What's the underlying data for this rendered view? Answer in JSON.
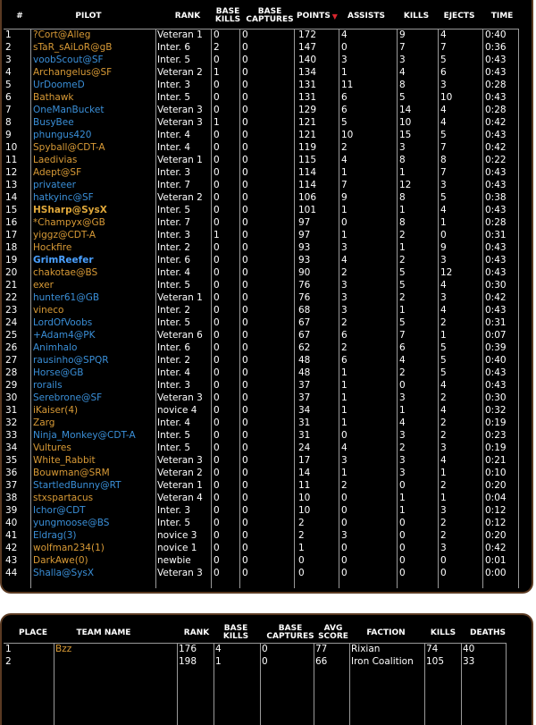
{
  "pilot_table": {
    "headers": {
      "num": "#",
      "pilot": "PILOT",
      "rank": "RANK",
      "base_kills": "BASE KILLS",
      "base_captures": "BASE CAPTURES",
      "points": "POINTS",
      "assists": "ASSISTS",
      "kills": "KILLS",
      "ejects": "EJECTS",
      "time": "TIME"
    },
    "sort_indicator": "▼",
    "colors": {
      "orange": "#d89a36",
      "blue": "#3a8fd8",
      "border": "#5a3a22",
      "sort": "#d8262e"
    },
    "rows": [
      {
        "num": "1",
        "pilot": "?Cort@Alleg",
        "team": "orange",
        "rank": "Veteran 1",
        "bk": "0",
        "bc": "0",
        "points": "172",
        "assists": "4",
        "kills": "9",
        "ejects": "4",
        "time": "0:40"
      },
      {
        "num": "2",
        "pilot": "sTaR_sAiLoR@gB",
        "team": "orange",
        "rank": "Inter. 6",
        "bk": "2",
        "bc": "0",
        "points": "147",
        "assists": "0",
        "kills": "7",
        "ejects": "7",
        "time": "0:36"
      },
      {
        "num": "3",
        "pilot": "voobScout@SF",
        "team": "blue",
        "rank": "Inter. 5",
        "bk": "0",
        "bc": "0",
        "points": "140",
        "assists": "3",
        "kills": "3",
        "ejects": "5",
        "time": "0:43"
      },
      {
        "num": "4",
        "pilot": "Archangelus@SF",
        "team": "orange",
        "rank": "Veteran 2",
        "bk": "1",
        "bc": "0",
        "points": "134",
        "assists": "1",
        "kills": "4",
        "ejects": "6",
        "time": "0:43"
      },
      {
        "num": "5",
        "pilot": "UrDoomeD",
        "team": "blue",
        "rank": "Inter. 3",
        "bk": "0",
        "bc": "0",
        "points": "131",
        "assists": "11",
        "kills": "8",
        "ejects": "3",
        "time": "0:28"
      },
      {
        "num": "6",
        "pilot": "Bathawk",
        "team": "orange",
        "rank": "Inter. 5",
        "bk": "0",
        "bc": "0",
        "points": "131",
        "assists": "6",
        "kills": "5",
        "ejects": "10",
        "time": "0:43"
      },
      {
        "num": "7",
        "pilot": "OneManBucket",
        "team": "blue",
        "rank": "Veteran 3",
        "bk": "0",
        "bc": "0",
        "points": "129",
        "assists": "6",
        "kills": "14",
        "ejects": "4",
        "time": "0:28"
      },
      {
        "num": "8",
        "pilot": "BusyBee",
        "team": "blue",
        "rank": "Veteran 3",
        "bk": "1",
        "bc": "0",
        "points": "121",
        "assists": "5",
        "kills": "10",
        "ejects": "4",
        "time": "0:42"
      },
      {
        "num": "9",
        "pilot": "phungus420",
        "team": "blue",
        "rank": "Inter. 4",
        "bk": "0",
        "bc": "0",
        "points": "121",
        "assists": "10",
        "kills": "15",
        "ejects": "5",
        "time": "0:43"
      },
      {
        "num": "10",
        "pilot": "Spyball@CDT-A",
        "team": "orange",
        "rank": "Inter. 4",
        "bk": "0",
        "bc": "0",
        "points": "119",
        "assists": "2",
        "kills": "3",
        "ejects": "7",
        "time": "0:42"
      },
      {
        "num": "11",
        "pilot": "Laedivias",
        "team": "orange",
        "rank": "Veteran 1",
        "bk": "0",
        "bc": "0",
        "points": "115",
        "assists": "4",
        "kills": "8",
        "ejects": "8",
        "time": "0:22"
      },
      {
        "num": "12",
        "pilot": "Adept@SF",
        "team": "orange",
        "rank": "Inter. 3",
        "bk": "0",
        "bc": "0",
        "points": "114",
        "assists": "1",
        "kills": "1",
        "ejects": "7",
        "time": "0:43"
      },
      {
        "num": "13",
        "pilot": "privateer",
        "team": "blue",
        "rank": "Inter. 7",
        "bk": "0",
        "bc": "0",
        "points": "114",
        "assists": "7",
        "kills": "12",
        "ejects": "3",
        "time": "0:43"
      },
      {
        "num": "14",
        "pilot": "hatkyinc@SF",
        "team": "blue",
        "rank": "Veteran 2",
        "bk": "0",
        "bc": "0",
        "points": "106",
        "assists": "9",
        "kills": "8",
        "ejects": "5",
        "time": "0:38"
      },
      {
        "num": "15",
        "pilot": "HSharp@SysX",
        "team": "orange-bold",
        "rank": "Inter. 5",
        "bk": "0",
        "bc": "0",
        "points": "101",
        "assists": "1",
        "kills": "1",
        "ejects": "4",
        "time": "0:43"
      },
      {
        "num": "16",
        "pilot": "*Champyx@GB",
        "team": "orange",
        "rank": "Inter. 7",
        "bk": "0",
        "bc": "0",
        "points": "97",
        "assists": "0",
        "kills": "8",
        "ejects": "1",
        "time": "0:28"
      },
      {
        "num": "17",
        "pilot": "yiggz@CDT-A",
        "team": "orange",
        "rank": "Inter. 3",
        "bk": "1",
        "bc": "0",
        "points": "97",
        "assists": "1",
        "kills": "2",
        "ejects": "0",
        "time": "0:31"
      },
      {
        "num": "18",
        "pilot": "Hockfire",
        "team": "orange",
        "rank": "Inter. 2",
        "bk": "0",
        "bc": "0",
        "points": "93",
        "assists": "3",
        "kills": "1",
        "ejects": "9",
        "time": "0:43"
      },
      {
        "num": "19",
        "pilot": "GrimReefer",
        "team": "blue-bold",
        "rank": "Inter. 6",
        "bk": "0",
        "bc": "0",
        "points": "93",
        "assists": "4",
        "kills": "2",
        "ejects": "3",
        "time": "0:43"
      },
      {
        "num": "20",
        "pilot": "chakotae@BS",
        "team": "orange",
        "rank": "Inter. 4",
        "bk": "0",
        "bc": "0",
        "points": "90",
        "assists": "2",
        "kills": "5",
        "ejects": "12",
        "time": "0:43"
      },
      {
        "num": "21",
        "pilot": "exer",
        "team": "orange",
        "rank": "Inter. 5",
        "bk": "0",
        "bc": "0",
        "points": "76",
        "assists": "3",
        "kills": "5",
        "ejects": "4",
        "time": "0:30"
      },
      {
        "num": "22",
        "pilot": "hunter61@GB",
        "team": "blue",
        "rank": "Veteran 1",
        "bk": "0",
        "bc": "0",
        "points": "76",
        "assists": "3",
        "kills": "2",
        "ejects": "3",
        "time": "0:42"
      },
      {
        "num": "23",
        "pilot": "vineco",
        "team": "orange",
        "rank": "Inter. 2",
        "bk": "0",
        "bc": "0",
        "points": "68",
        "assists": "3",
        "kills": "1",
        "ejects": "4",
        "time": "0:43"
      },
      {
        "num": "24",
        "pilot": "LordOfVoobs",
        "team": "blue",
        "rank": "Inter. 5",
        "bk": "0",
        "bc": "0",
        "points": "67",
        "assists": "2",
        "kills": "5",
        "ejects": "2",
        "time": "0:31"
      },
      {
        "num": "25",
        "pilot": "+Adam4@PK",
        "team": "blue",
        "rank": "Veteran 6",
        "bk": "0",
        "bc": "0",
        "points": "67",
        "assists": "6",
        "kills": "7",
        "ejects": "1",
        "time": "0:07"
      },
      {
        "num": "26",
        "pilot": "Animhalo",
        "team": "blue",
        "rank": "Inter. 6",
        "bk": "0",
        "bc": "0",
        "points": "62",
        "assists": "2",
        "kills": "6",
        "ejects": "5",
        "time": "0:39"
      },
      {
        "num": "27",
        "pilot": "rausinho@SPQR",
        "team": "blue",
        "rank": "Inter. 2",
        "bk": "0",
        "bc": "0",
        "points": "48",
        "assists": "6",
        "kills": "4",
        "ejects": "5",
        "time": "0:40"
      },
      {
        "num": "28",
        "pilot": "Horse@GB",
        "team": "blue",
        "rank": "Inter. 4",
        "bk": "0",
        "bc": "0",
        "points": "48",
        "assists": "1",
        "kills": "2",
        "ejects": "5",
        "time": "0:43"
      },
      {
        "num": "29",
        "pilot": "rorails",
        "team": "blue",
        "rank": "Inter. 3",
        "bk": "0",
        "bc": "0",
        "points": "37",
        "assists": "1",
        "kills": "0",
        "ejects": "4",
        "time": "0:43"
      },
      {
        "num": "30",
        "pilot": "Serebrone@SF",
        "team": "blue",
        "rank": "Veteran 3",
        "bk": "0",
        "bc": "0",
        "points": "37",
        "assists": "1",
        "kills": "3",
        "ejects": "2",
        "time": "0:30"
      },
      {
        "num": "31",
        "pilot": "iKaiser(4)",
        "team": "orange",
        "rank": "novice 4",
        "bk": "0",
        "bc": "0",
        "points": "34",
        "assists": "1",
        "kills": "1",
        "ejects": "4",
        "time": "0:32"
      },
      {
        "num": "32",
        "pilot": "Zarg",
        "team": "orange",
        "rank": "Inter. 4",
        "bk": "0",
        "bc": "0",
        "points": "31",
        "assists": "1",
        "kills": "4",
        "ejects": "2",
        "time": "0:19"
      },
      {
        "num": "33",
        "pilot": "Ninja_Monkey@CDT-A",
        "team": "blue",
        "rank": "Inter. 5",
        "bk": "0",
        "bc": "0",
        "points": "31",
        "assists": "0",
        "kills": "3",
        "ejects": "2",
        "time": "0:23"
      },
      {
        "num": "34",
        "pilot": "Vultures",
        "team": "orange",
        "rank": "Inter. 5",
        "bk": "0",
        "bc": "0",
        "points": "24",
        "assists": "4",
        "kills": "2",
        "ejects": "3",
        "time": "0:19"
      },
      {
        "num": "35",
        "pilot": "White_Rabbit",
        "team": "orange",
        "rank": "Veteran 3",
        "bk": "0",
        "bc": "0",
        "points": "17",
        "assists": "3",
        "kills": "3",
        "ejects": "4",
        "time": "0:21"
      },
      {
        "num": "36",
        "pilot": "Bouwman@SRM",
        "team": "orange",
        "rank": "Veteran 2",
        "bk": "0",
        "bc": "0",
        "points": "14",
        "assists": "1",
        "kills": "3",
        "ejects": "1",
        "time": "0:10"
      },
      {
        "num": "37",
        "pilot": "StartledBunny@RT",
        "team": "blue",
        "rank": "Veteran 1",
        "bk": "0",
        "bc": "0",
        "points": "11",
        "assists": "2",
        "kills": "0",
        "ejects": "2",
        "time": "0:20"
      },
      {
        "num": "38",
        "pilot": "stxspartacus",
        "team": "orange",
        "rank": "Veteran 4",
        "bk": "0",
        "bc": "0",
        "points": "10",
        "assists": "0",
        "kills": "1",
        "ejects": "1",
        "time": "0:04"
      },
      {
        "num": "39",
        "pilot": "Ichor@CDT",
        "team": "blue",
        "rank": "Inter. 3",
        "bk": "0",
        "bc": "0",
        "points": "10",
        "assists": "0",
        "kills": "1",
        "ejects": "3",
        "time": "0:12"
      },
      {
        "num": "40",
        "pilot": "yungmoose@BS",
        "team": "blue",
        "rank": "Inter. 5",
        "bk": "0",
        "bc": "0",
        "points": "2",
        "assists": "0",
        "kills": "0",
        "ejects": "2",
        "time": "0:12"
      },
      {
        "num": "41",
        "pilot": "Eldrag(3)",
        "team": "blue",
        "rank": "novice 3",
        "bk": "0",
        "bc": "0",
        "points": "2",
        "assists": "3",
        "kills": "0",
        "ejects": "2",
        "time": "0:20"
      },
      {
        "num": "42",
        "pilot": "wolfman234(1)",
        "team": "orange",
        "rank": "novice 1",
        "bk": "0",
        "bc": "0",
        "points": "1",
        "assists": "0",
        "kills": "0",
        "ejects": "3",
        "time": "0:42"
      },
      {
        "num": "43",
        "pilot": "DarkAwe(0)",
        "team": "orange",
        "rank": "newbie",
        "bk": "0",
        "bc": "0",
        "points": "0",
        "assists": "0",
        "kills": "0",
        "ejects": "0",
        "time": "0:01"
      },
      {
        "num": "44",
        "pilot": "Shalla@SysX",
        "team": "blue",
        "rank": "Veteran 3",
        "bk": "0",
        "bc": "0",
        "points": "0",
        "assists": "0",
        "kills": "0",
        "ejects": "0",
        "time": "0:00"
      }
    ]
  },
  "team_table": {
    "headers": {
      "place": "PLACE",
      "team_name": "TEAM NAME",
      "rank": "RANK",
      "base_kills": "BASE KILLS",
      "base_captures": "BASE CAPTURES",
      "avg_score": "AVG SCORE",
      "faction": "FACTION",
      "kills": "KILLS",
      "deaths": "DEATHS"
    },
    "rows": [
      {
        "place": "1",
        "team_name": "Bzz",
        "team": "orange",
        "rank": "176",
        "bk": "4",
        "bc": "0",
        "avg": "77",
        "faction": "Rixian",
        "kills": "74",
        "deaths": "40"
      },
      {
        "place": "2",
        "team_name": "",
        "team": "blue",
        "rank": "198",
        "bk": "1",
        "bc": "0",
        "avg": "66",
        "faction": "Iron Coalition",
        "kills": "105",
        "deaths": "33"
      }
    ]
  }
}
